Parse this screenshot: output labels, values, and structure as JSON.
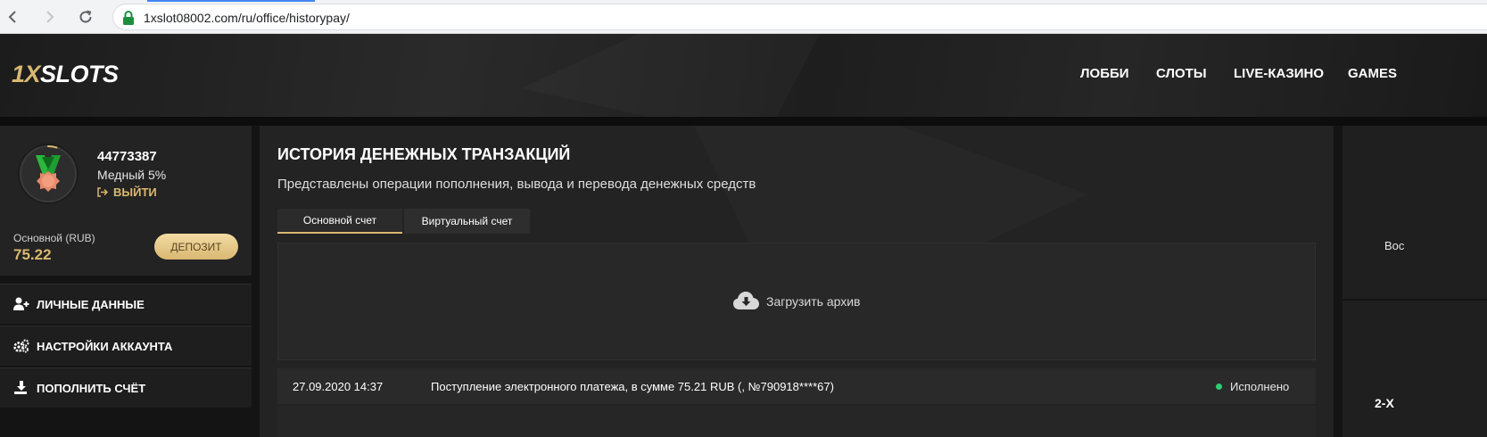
{
  "browser": {
    "url": "1xslot08002.com/ru/office/historypay/"
  },
  "header": {
    "logo_part1": "1X",
    "logo_part2": "SLOTS",
    "nav": [
      {
        "label": "ЛОББИ"
      },
      {
        "label": "СЛОТЫ"
      },
      {
        "label": "LIVE-КАЗИНО"
      },
      {
        "label": "GAMES"
      }
    ]
  },
  "profile": {
    "user_id": "44773387",
    "level": "Медный 5%",
    "logout_label": "ВЫЙТИ",
    "balance_label": "Основной (RUB)",
    "balance_value": "75.22",
    "deposit_label": "ДЕПОЗИТ",
    "level_progress": 0.05
  },
  "sidebar": {
    "items": [
      {
        "label": "ЛИЧНЫЕ ДАННЫЕ",
        "icon": "user-plus-icon"
      },
      {
        "label": "НАСТРОЙКИ АККАУНТА",
        "icon": "gears-icon"
      },
      {
        "label": "ПОПОЛНИТЬ СЧЁТ",
        "icon": "download-icon"
      }
    ]
  },
  "main": {
    "title": "ИСТОРИЯ ДЕНЕЖНЫХ ТРАНЗАКЦИЙ",
    "subtitle": "Представлены операции пополнения, вывода и перевода денежных средств",
    "tabs": [
      {
        "label": "Основной счет",
        "active": true
      },
      {
        "label": "Виртуальный счет",
        "active": false
      }
    ],
    "archive_label": "Загрузить архив",
    "transactions": [
      {
        "date": "27.09.2020 14:37",
        "description": "Поступление электронного платежа, в сумме 75.21 RUB (, №790918****67)",
        "status": "Исполнено",
        "status_color": "#2ecc71"
      }
    ]
  },
  "right_panel": {
    "text_1": "Вос",
    "text_2": "2-Х"
  },
  "colors": {
    "accent": "#d9b871",
    "background": "#171717",
    "panel": "#232323"
  }
}
